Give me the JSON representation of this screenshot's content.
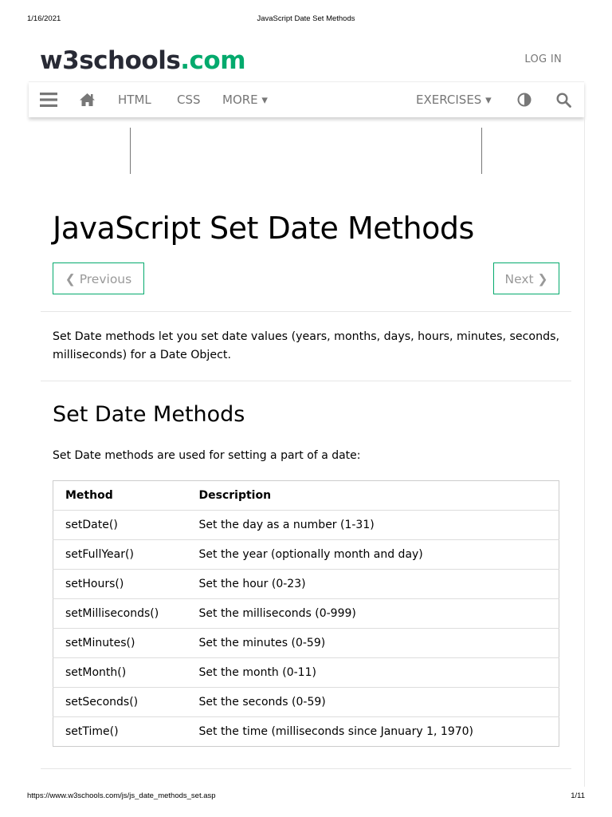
{
  "print_header": {
    "date": "1/16/2021",
    "title": "JavaScript Date Set Methods"
  },
  "print_footer": {
    "url": "https://www.w3schools.com/js/js_date_methods_set.asp",
    "page": "1/11"
  },
  "header": {
    "logo_main": "w3schools",
    "logo_tld": ".com",
    "login_label": "LOG IN"
  },
  "topnav": {
    "icons": [
      "menu-icon",
      "home-icon",
      "contrast-icon",
      "search-icon"
    ],
    "items": [
      {
        "label": "HTML"
      },
      {
        "label": "CSS"
      },
      {
        "label": "MORE ▾"
      },
      {
        "label": "EXERCISES ▾"
      }
    ]
  },
  "colors": {
    "brand_green": "#04aa6d",
    "logo_dark": "#282a35",
    "nav_text": "#777777"
  },
  "main": {
    "title": "JavaScript Set Date Methods",
    "prev_label": "❮ Previous",
    "next_label": "Next ❯",
    "intro": "Set Date methods let you set date values (years, months, days, hours, minutes, seconds, milliseconds) for a Date Object.",
    "section_title": "Set Date Methods",
    "section_sub": "Set Date methods are used for setting a part of a date:",
    "table": {
      "headers": [
        "Method",
        "Description"
      ],
      "rows": [
        [
          "setDate()",
          "Set the day as a number (1-31)"
        ],
        [
          "setFullYear()",
          "Set the year (optionally month and day)"
        ],
        [
          "setHours()",
          "Set the hour (0-23)"
        ],
        [
          "setMilliseconds()",
          "Set the milliseconds (0-999)"
        ],
        [
          "setMinutes()",
          "Set the minutes (0-59)"
        ],
        [
          "setMonth()",
          "Set the month (0-11)"
        ],
        [
          "setSeconds()",
          "Set the seconds (0-59)"
        ],
        [
          "setTime()",
          "Set the time (milliseconds since January 1, 1970)"
        ]
      ]
    }
  }
}
